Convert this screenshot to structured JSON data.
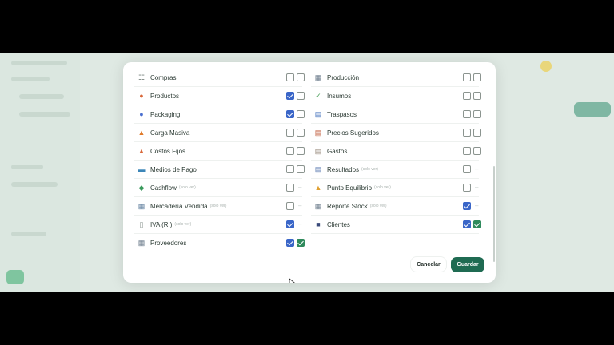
{
  "left_column": [
    {
      "label": "Compras",
      "tag": "",
      "icon": "cart-icon",
      "glyph": "☷",
      "color": "#7a8580",
      "c1": "off",
      "c2": "off"
    },
    {
      "label": "Productos",
      "tag": "",
      "icon": "product-icon",
      "glyph": "●",
      "color": "#d9683a",
      "c1": "blue",
      "c2": "off"
    },
    {
      "label": "Packaging",
      "tag": "",
      "icon": "packaging-icon",
      "glyph": "●",
      "color": "#4a6fd0",
      "c1": "blue",
      "c2": "off"
    },
    {
      "label": "Carga Masiva",
      "tag": "",
      "icon": "bulk-upload-icon",
      "glyph": "▲",
      "color": "#e07a2a",
      "c1": "off",
      "c2": "off"
    },
    {
      "label": "Costos Fijos",
      "tag": "",
      "icon": "fixed-costs-icon",
      "glyph": "▲",
      "color": "#d9683a",
      "c1": "off",
      "c2": "off"
    },
    {
      "label": "Medios de Pago",
      "tag": "",
      "icon": "payment-methods-icon",
      "glyph": "▬",
      "color": "#3c86b8",
      "c1": "off",
      "c2": "off"
    },
    {
      "label": "Cashflow",
      "tag": "(solo ver)",
      "icon": "cashflow-icon",
      "glyph": "◆",
      "color": "#3a9a5c",
      "c1": "off",
      "c2": "dash"
    },
    {
      "label": "Mercadería Vendida",
      "tag": "(solo ver)",
      "icon": "sold-goods-icon",
      "glyph": "▦",
      "color": "#5a7a9a",
      "c1": "off",
      "c2": "dash"
    },
    {
      "label": "IVA (RI)",
      "tag": "(solo ver)",
      "icon": "tax-icon",
      "glyph": "▯",
      "color": "#8a9590",
      "c1": "blue",
      "c2": "dash"
    },
    {
      "label": "Proveedores",
      "tag": "",
      "icon": "suppliers-icon",
      "glyph": "▦",
      "color": "#6a7a8a",
      "c1": "blue",
      "c2": "green"
    }
  ],
  "right_column": [
    {
      "label": "Producción",
      "tag": "",
      "icon": "production-icon",
      "glyph": "▦",
      "color": "#6a7a8a",
      "c1": "off",
      "c2": "off"
    },
    {
      "label": "Insumos",
      "tag": "",
      "icon": "supplies-icon",
      "glyph": "✓",
      "color": "#4aa05a",
      "c1": "off",
      "c2": "off"
    },
    {
      "label": "Traspasos",
      "tag": "",
      "icon": "transfers-icon",
      "glyph": "▤",
      "color": "#3a6ab8",
      "c1": "off",
      "c2": "off"
    },
    {
      "label": "Precios Sugeridos",
      "tag": "",
      "icon": "suggested-prices-icon",
      "glyph": "▤",
      "color": "#c05a3a",
      "c1": "off",
      "c2": "off"
    },
    {
      "label": "Gastos",
      "tag": "",
      "icon": "expenses-icon",
      "glyph": "▤",
      "color": "#8a7a6a",
      "c1": "off",
      "c2": "off"
    },
    {
      "label": "Resultados",
      "tag": "(solo ver)",
      "icon": "results-icon",
      "glyph": "▤",
      "color": "#5a7ab0",
      "c1": "off",
      "c2": "dash"
    },
    {
      "label": "Punto Equilibrio",
      "tag": "(solo ver)",
      "icon": "break-even-icon",
      "glyph": "▲",
      "color": "#e0a030",
      "c1": "off",
      "c2": "dash"
    },
    {
      "label": "Reporte Stock",
      "tag": "(solo ver)",
      "icon": "stock-report-icon",
      "glyph": "▦",
      "color": "#6a7a8a",
      "c1": "blue",
      "c2": "dash"
    },
    {
      "label": "Clientes",
      "tag": "",
      "icon": "clients-icon",
      "glyph": "■",
      "color": "#3a4a7a",
      "c1": "blue",
      "c2": "green"
    }
  ],
  "footer": {
    "cancel_label": "Cancelar",
    "save_label": "Guardar"
  },
  "colors": {
    "accent": "#1f6b52",
    "checkbox_blue": "#3a66c8",
    "checkbox_green": "#2f8a5c"
  }
}
